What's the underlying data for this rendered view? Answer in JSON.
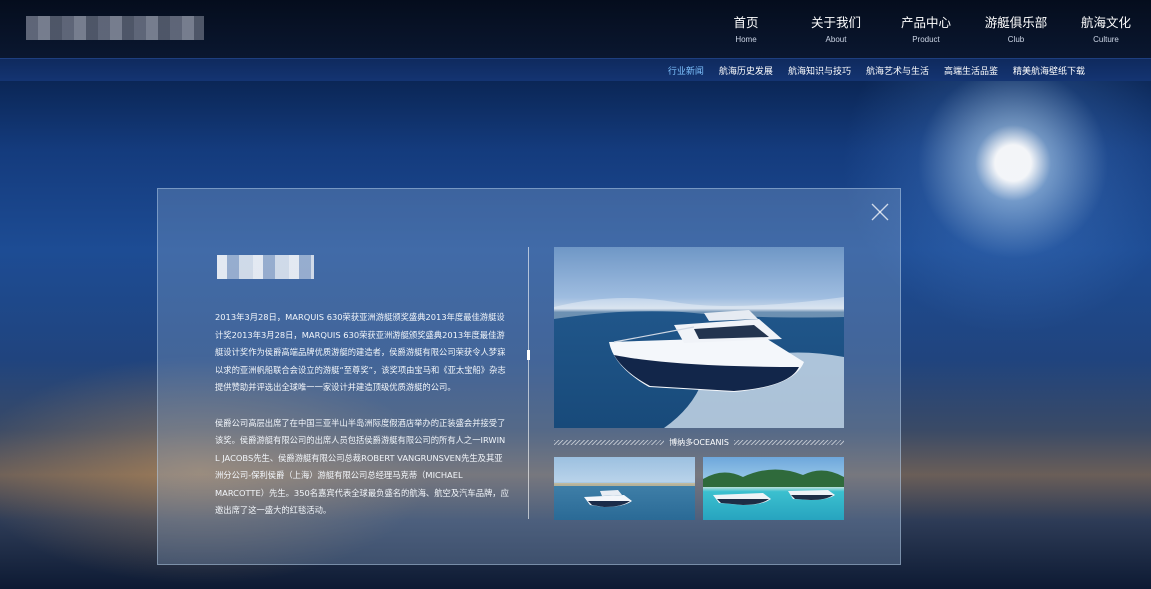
{
  "nav": {
    "items": [
      {
        "cn": "首页",
        "en": "Home"
      },
      {
        "cn": "关于我们",
        "en": "About"
      },
      {
        "cn": "产品中心",
        "en": "Product"
      },
      {
        "cn": "游艇俱乐部",
        "en": "Club"
      },
      {
        "cn": "航海文化",
        "en": "Culture"
      }
    ]
  },
  "subnav": {
    "items": [
      "行业新闻",
      "航海历史发展",
      "航海知识与技巧",
      "航海艺术与生活",
      "高端生活品鉴",
      "精美航海壁纸下载"
    ],
    "active_index": 0
  },
  "article": {
    "paragraphs": [
      "2013年3月28日，MARQUIS 630荣获亚洲游艇颁奖盛典2013年度最佳游艇设计奖2013年3月28日，MARQUIS 630荣获亚洲游艇颁奖盛典2013年度最佳游艇设计奖作为侯爵高端品牌优质游艇的建造者，侯爵游艇有限公司荣获令人梦寐以求的亚洲帆船联合会设立的游艇“至尊奖”，该奖项由宝马和《亚太宝船》杂志提供赞助并评选出全球唯一一家设计并建造顶级优质游艇的公司。",
      "侯爵公司高层出席了在中国三亚半山半岛洲际度假酒店举办的正装盛会并接受了该奖。侯爵游艇有限公司的出席人员包括侯爵游艇有限公司的所有人之一IRWIN L JACOBS先生、侯爵游艇有限公司总裁ROBERT VANGRUNSVEN先生及其亚洲分公司-保利侯爵（上海）游艇有限公司总经理马克蒂（MICHAEL MARCOTTE）先生。350名嘉宾代表全球最负盛名的航海、航空及汽车品牌，应邀出席了这一盛大的红毯活动。"
    ]
  },
  "gallery": {
    "caption": "博纳多OCEANIS"
  },
  "colors": {
    "active_subnav": "#7fc3ff",
    "topbar": "#050d1d",
    "subbar": "#143472"
  }
}
